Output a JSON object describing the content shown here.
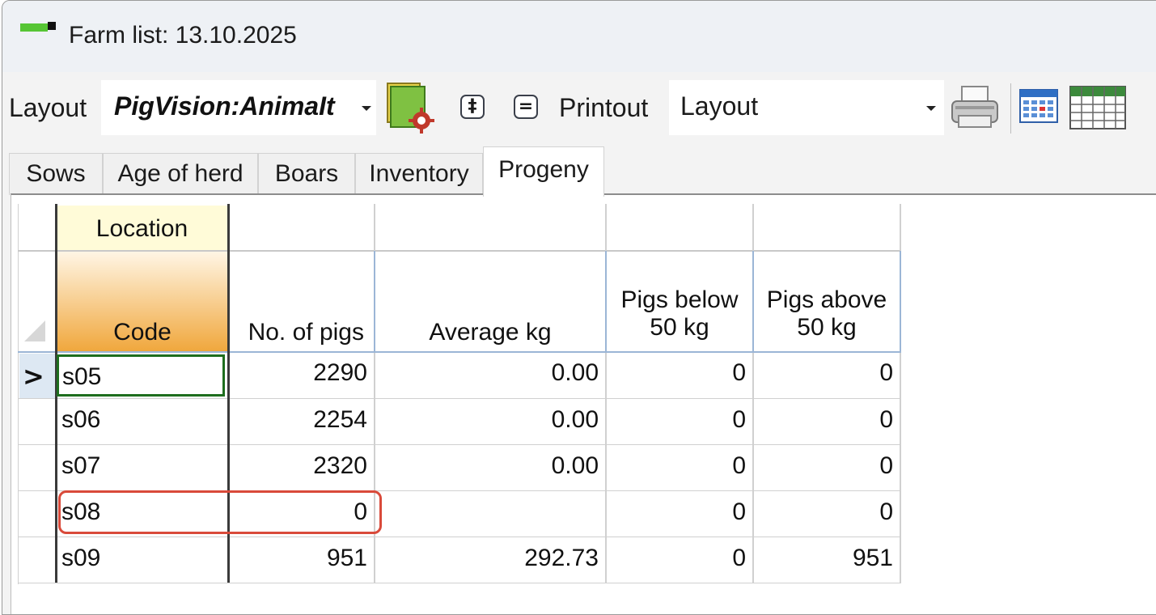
{
  "window": {
    "title": "Farm list: 13.10.2025"
  },
  "toolbar": {
    "layout_label": "Layout",
    "layout_value": "PigVision:AnimaIt",
    "layout_buttons": [
      "‡",
      "="
    ],
    "printout_label": "Printout",
    "printout_value": "Layout"
  },
  "tabs": [
    {
      "label": "Sows",
      "active": false
    },
    {
      "label": "Age of herd",
      "active": false
    },
    {
      "label": "Boars",
      "active": false
    },
    {
      "label": "Inventory",
      "active": false
    },
    {
      "label": "Progeny",
      "active": true
    }
  ],
  "grid": {
    "group_header": "Location",
    "columns": [
      "Code",
      "No. of pigs",
      "Average kg",
      "Pigs below 50 kg",
      "Pigs above 50 kg"
    ],
    "row_indicator": ">",
    "rows": [
      [
        "s05",
        "2290",
        "0.00",
        "0",
        "0"
      ],
      [
        "s06",
        "2254",
        "0.00",
        "0",
        "0"
      ],
      [
        "s07",
        "2320",
        "0.00",
        "0",
        "0"
      ],
      [
        "s08",
        "0",
        "",
        "0",
        "0"
      ],
      [
        "s09",
        "951",
        "292.73",
        "0",
        "951"
      ]
    ]
  },
  "colors": {
    "code_header_top": "#fff4d8",
    "code_header_bottom": "#f0a63a",
    "location_header": "#fffbd8",
    "selected_cell_border": "#1e6e1e",
    "highlight_outline": "#d94a3a"
  }
}
